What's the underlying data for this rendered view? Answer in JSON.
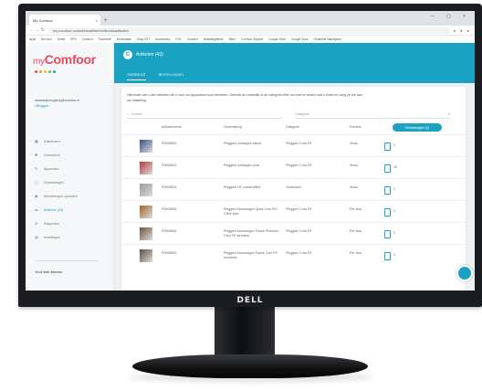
{
  "browser": {
    "tab_title": "My Comfoor",
    "tab_close": "×",
    "new_tab": "+",
    "window_controls": "– ▢ ×",
    "nav_buttons": "← → ↻",
    "url": "my.comfoor.com/nl/bestellen/verbruiksartikelen",
    "bookmarks": [
      "Apps",
      "Bol.com",
      "Gmail",
      "KPN",
      "Comfoor",
      "Facebook",
      "Bookmarks",
      "Shop NTT",
      "Bookmarks",
      "FNV",
      "Comfoor",
      "Belastingdienst",
      "Weer",
      "Comfoor Support",
      "Google Drive",
      "Google Docs",
      "Gedeelde bladwijzers"
    ]
  },
  "sidebar": {
    "logo_prefix": "my",
    "logo_name": "Comfoor",
    "dot_colors": [
      "#e8495e",
      "#f29c38",
      "#f2c230",
      "#7ab648",
      "#1aa2c2"
    ],
    "user_email": "baslawijkhoogterp@comfoor.nl",
    "logout": "Uitloggen",
    "items": [
      {
        "icon": "▦",
        "label": "Dashboard",
        "active": false
      },
      {
        "icon": "✚",
        "label": "Gebruikers",
        "active": false
      },
      {
        "icon": "✎",
        "label": "Apparaten",
        "active": false
      },
      {
        "icon": "▢",
        "label": "Opmerkingen",
        "active": false
      },
      {
        "icon": "◉",
        "label": "Afbeeldingen uploaden",
        "active": false
      },
      {
        "icon": "⇆",
        "label": "Artikelen (43)",
        "active": true
      },
      {
        "icon": "⟳",
        "label": "Rapporten",
        "active": false
      },
      {
        "icon": "▤",
        "label": "Instellingen",
        "active": false
      }
    ],
    "footer": "Your web listener"
  },
  "header": {
    "avatar_letter": "C",
    "title": "Artikelen (43)",
    "tabs": [
      {
        "label": "OVERZICHT",
        "active": true
      },
      {
        "label": "BESTELLINGEN",
        "active": false
      }
    ]
  },
  "content": {
    "intro": "Hieronder ziet u alle artikelen die u voor uw apparatuur kunt bestellen. Gebruik de zoekbalk of de categorie-filter om snel te vinden wat u zoekt en voeg ze toe aan uw bestelling.",
    "search_placeholder": "Zoeken",
    "category_placeholder": "Categorie",
    "columns": [
      "Artikelnummer",
      "Omschrijving",
      "Categorie",
      "Eenheid"
    ],
    "cart_button": "Winkelwagen (0)",
    "rows": [
      {
        "code": "P0008500",
        "desc": "Pluggerz oorkapjes blauw",
        "category": "Pluggerz Com-Fit",
        "unit": "Stuks",
        "qty": "1",
        "thumb": "#3a4f8a"
      },
      {
        "code": "P0008502",
        "desc": "Pluggerz oorkapjes rood",
        "category": "Pluggerz Com-Fit",
        "unit": "Stuks",
        "qty": "10",
        "thumb": "#b23a3a"
      },
      {
        "code": "P0008504",
        "desc": "Pluggerz UF ontwerpfilter",
        "category": "Onderdeel",
        "unit": "Stuks",
        "qty": "1",
        "thumb": "#9a9aa2"
      },
      {
        "code": "P0008505",
        "desc": "Pluggerz bewaringen Quiet Com-Fit / OHM-Max",
        "category": "Pluggerz Com-Fit",
        "unit": "Per stuk",
        "qty": "1",
        "thumb": "#a0642a"
      },
      {
        "code": "P0008506",
        "desc": "Pluggerz bewaringen Flame Premium Com-Fit Inzetstuk",
        "category": "Pluggerz Com-Fit",
        "unit": "Per stuk",
        "qty": "1",
        "thumb": "#6a5240"
      },
      {
        "code": "P0008509",
        "desc": "Pluggerz bewaringen Flame Com-Fit Inzetstuk",
        "category": "Pluggerz Com-Fit",
        "unit": "Per stuk",
        "qty": "1",
        "thumb": "#5e4a3c"
      }
    ]
  },
  "monitor": {
    "brand": "DELL"
  }
}
